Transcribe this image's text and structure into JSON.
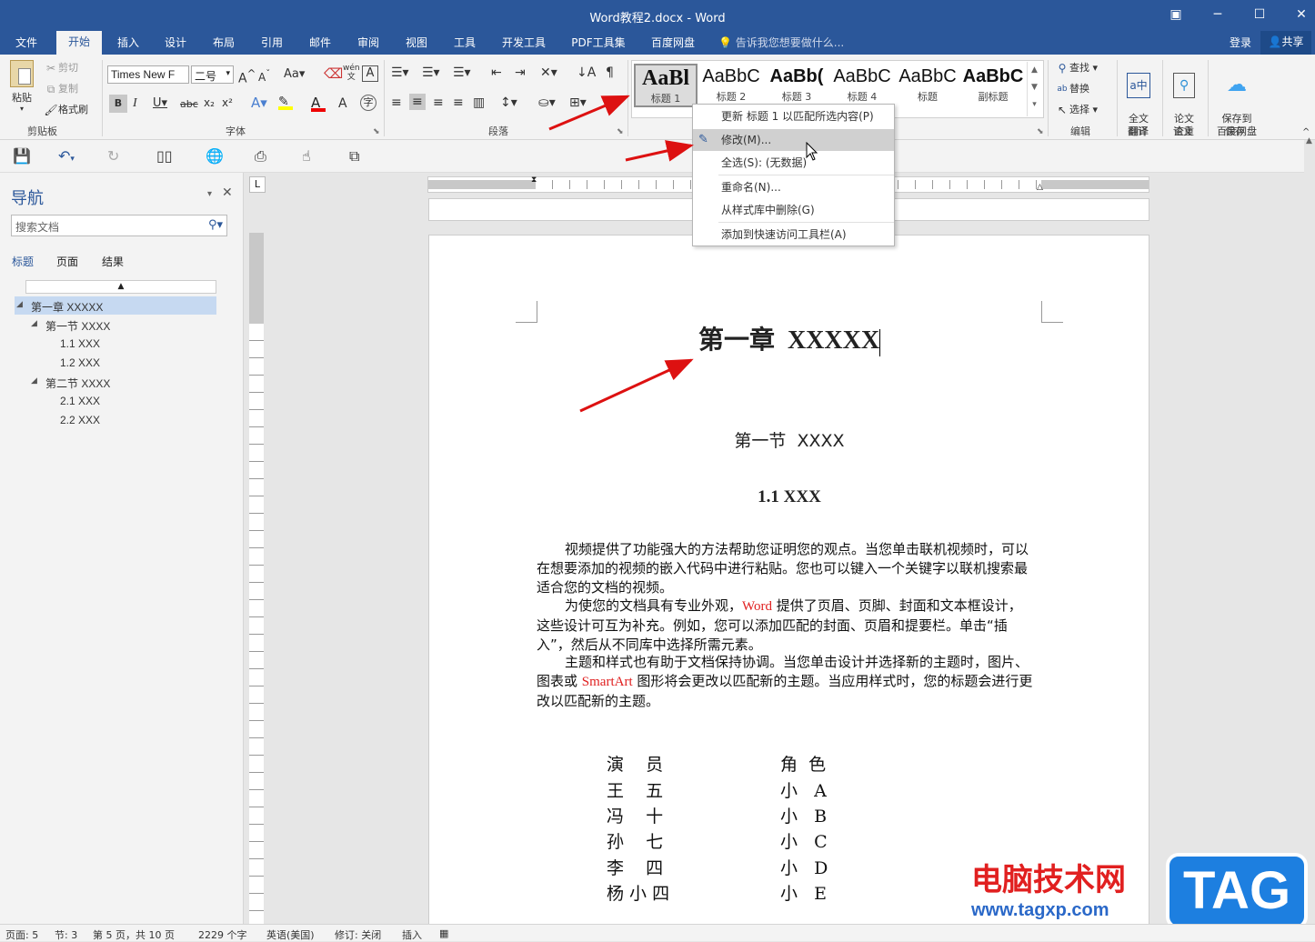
{
  "window": {
    "title": "Word教程2.docx - Word",
    "controls": [
      "restore-ribbon",
      "minimize",
      "maximize",
      "close"
    ]
  },
  "menu": {
    "tabs": [
      "文件",
      "开始",
      "插入",
      "设计",
      "布局",
      "引用",
      "邮件",
      "审阅",
      "视图",
      "工具",
      "开发工具",
      "PDF工具集",
      "百度网盘"
    ],
    "active_tab": "开始",
    "tell_me": "告诉我您想要做什么...",
    "login": "登录",
    "share": "共享"
  },
  "ribbon": {
    "clipboard": {
      "paste": "粘贴",
      "cut": "剪切",
      "copy": "复制",
      "format_painter": "格式刷",
      "label": "剪贴板"
    },
    "font": {
      "family": "Times New F",
      "size": "二号",
      "label": "字体",
      "case": "Aa",
      "pinyin": "wén",
      "bold": "B",
      "italic": "I",
      "underline": "U",
      "strike": "abc",
      "sub": "x₂",
      "sup": "x²"
    },
    "paragraph": {
      "label": "段落"
    },
    "styles": {
      "items": [
        {
          "sample": "AaBl",
          "name": "标题 1"
        },
        {
          "sample": "AaBbC",
          "name": "标题 2"
        },
        {
          "sample": "AaBb(",
          "name": "标题 3"
        },
        {
          "sample": "AaBbC",
          "name": "标题 4"
        },
        {
          "sample": "AaBbC",
          "name": "标题"
        },
        {
          "sample": "AaBbC",
          "name": "副标题"
        }
      ]
    },
    "editing": {
      "find": "查找",
      "replace": "替换",
      "select": "选择",
      "label": "编辑"
    },
    "translate": {
      "btn": "全文\n翻译",
      "label": "翻译"
    },
    "paper": {
      "btn": "论文\n查重",
      "label": "论文"
    },
    "save": {
      "btn": "保存到\n百度网盘",
      "label": "保存"
    }
  },
  "context_menu": {
    "items": [
      "更新 标题 1 以匹配所选内容(P)",
      "修改(M)...",
      "全选(S): (无数据)",
      "重命名(N)...",
      "从样式库中删除(G)",
      "添加到快速访问工具栏(A)"
    ],
    "highlighted_index": 1
  },
  "nav": {
    "title": "导航",
    "search_placeholder": "搜索文档",
    "tabs": [
      "标题",
      "页面",
      "结果"
    ],
    "active_tab": "标题",
    "tree": [
      {
        "text": "第一章 XXXXX",
        "level": 0,
        "selected": true
      },
      {
        "text": "第一节 XXXX",
        "level": 1
      },
      {
        "text": "1.1 XXX",
        "level": 2
      },
      {
        "text": "1.2 XXX",
        "level": 2
      },
      {
        "text": "第二节 XXXX",
        "level": 1
      },
      {
        "text": "2.1 XXX",
        "level": 2
      },
      {
        "text": "2.2 XXX",
        "level": 2
      }
    ]
  },
  "document": {
    "heading1": "第一章  XXXXX",
    "heading2": "第一节  XXXX",
    "heading3": "1.1 XXX",
    "paragraphs": [
      "视频提供了功能强大的方法帮助您证明您的观点。当您单击联机视频时，可以在想要添加的视频的嵌入代码中进行粘贴。您也可以键入一个关键字以联机搜索最适合您的文档的视频。",
      "为使您的文档具有专业外观，|Word| 提供了页眉、页脚、封面和文本框设计，这些设计可互为补充。例如，您可以添加匹配的封面、页眉和提要栏。单击“插入”，然后从不同库中选择所需元素。",
      "主题和样式也有助于文档保持协调。当您单击设计并选择新的主题时，图片、图表或 |SmartArt| 图形将会更改以匹配新的主题。当应用样式时，您的标题会进行更改以匹配新的主题。"
    ],
    "cast_header": [
      "演    员",
      "角  色"
    ],
    "cast": [
      [
        "王    五",
        "小   A"
      ],
      [
        "冯    十",
        "小   B"
      ],
      [
        "孙    七",
        "小   C"
      ],
      [
        "李    四",
        "小   D"
      ],
      [
        "杨 小 四",
        "小   E"
      ]
    ]
  },
  "status": {
    "page": "页面: 5",
    "section": "节: 3",
    "pages": "第 5 页，共 10 页",
    "words": "2229 个字",
    "lang": "英语(美国)",
    "revision": "修订: 关闭",
    "insert": "插入"
  },
  "watermark": {
    "site_name": "电脑技术网",
    "url": "www.tagxp.com",
    "badge": "TAG"
  },
  "colors": {
    "brand": "#2b579a",
    "red_text": "#e02020",
    "annotation_arrow": "#dd1111"
  }
}
